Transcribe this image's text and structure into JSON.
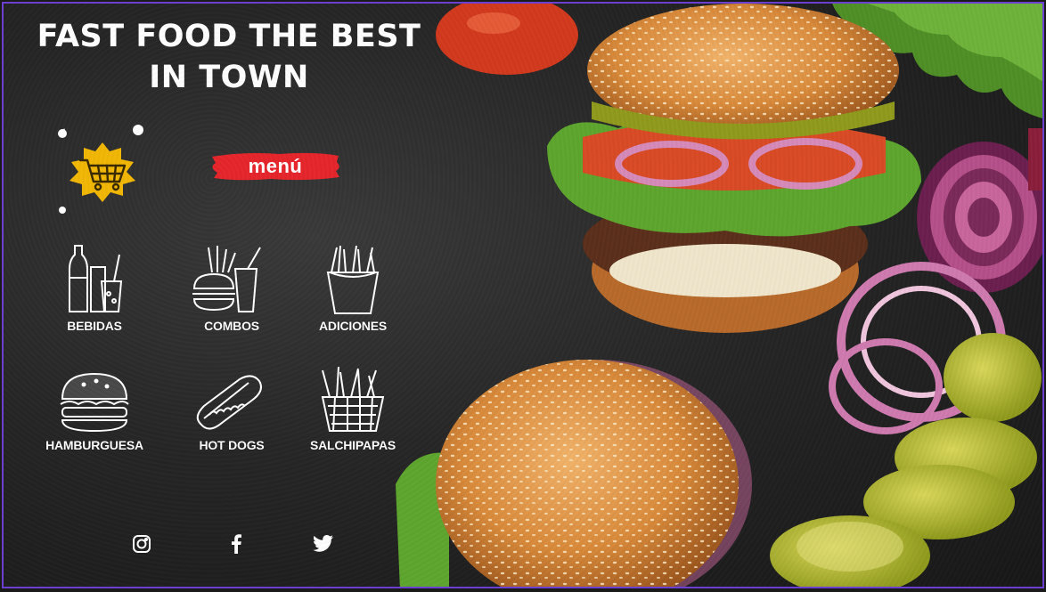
{
  "title": {
    "line1": "FAST FOOD THE BEST",
    "line2": "IN TOWN"
  },
  "menu_badge": {
    "label": "menú"
  },
  "categories": [
    {
      "label": "BEBIDAS",
      "icon": "drinks-icon"
    },
    {
      "label": "COMBOS",
      "icon": "combo-icon"
    },
    {
      "label": "ADICIONES",
      "icon": "fries-icon"
    },
    {
      "label": "HAMBURGUESA",
      "icon": "burger-icon"
    },
    {
      "label": "HOT DOGS",
      "icon": "hotdog-icon"
    },
    {
      "label": "SALCHIPAPAS",
      "icon": "basket-fries-icon"
    }
  ],
  "social": [
    {
      "icon": "instagram-icon"
    },
    {
      "icon": "facebook-icon"
    },
    {
      "icon": "twitter-icon"
    }
  ],
  "colors": {
    "background": "#262626",
    "border": "#6b3fd0",
    "cart_badge": "#f2b705",
    "menu_badge": "#e5262c",
    "text": "#ffffff"
  }
}
